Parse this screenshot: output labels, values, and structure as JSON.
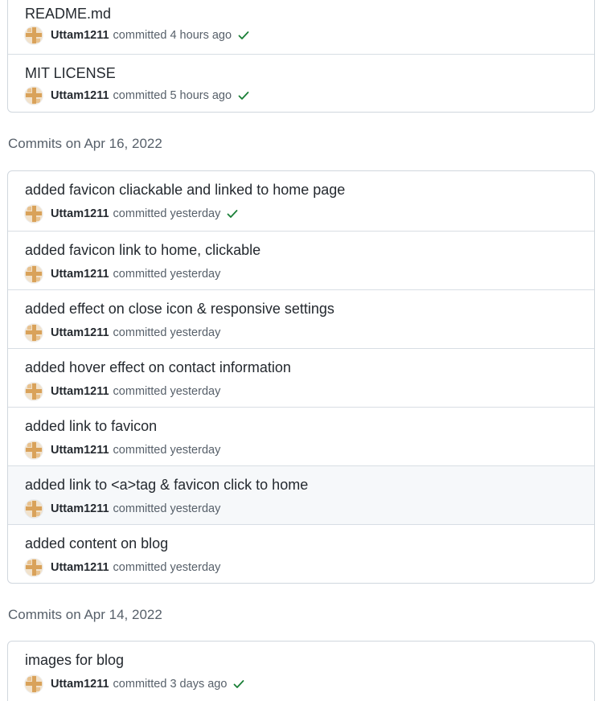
{
  "groups_top": {
    "commits": [
      {
        "title": "README.md",
        "author": "Uttam1211",
        "verb": "committed",
        "time": "4 hours ago",
        "status": "success"
      },
      {
        "title": "MIT LICENSE",
        "author": "Uttam1211",
        "verb": "committed",
        "time": "5 hours ago",
        "status": "success"
      }
    ]
  },
  "group_apr16": {
    "heading": "Commits on Apr 16, 2022",
    "commits": [
      {
        "title": "added favicon cliackable and linked to home page",
        "author": "Uttam1211",
        "verb": "committed",
        "time": "yesterday",
        "status": "success"
      },
      {
        "title": "added favicon link to home, clickable",
        "author": "Uttam1211",
        "verb": "committed",
        "time": "yesterday"
      },
      {
        "title": "added effect on close icon & responsive settings",
        "author": "Uttam1211",
        "verb": "committed",
        "time": "yesterday"
      },
      {
        "title": "added hover effect on contact information",
        "author": "Uttam1211",
        "verb": "committed",
        "time": "yesterday"
      },
      {
        "title": "added link to favicon",
        "author": "Uttam1211",
        "verb": "committed",
        "time": "yesterday"
      },
      {
        "title": "added link to <a>tag & favicon click to home",
        "author": "Uttam1211",
        "verb": "committed",
        "time": "yesterday"
      },
      {
        "title": "added content on blog",
        "author": "Uttam1211",
        "verb": "committed",
        "time": "yesterday"
      }
    ]
  },
  "group_apr14": {
    "heading": "Commits on Apr 14, 2022",
    "commits": [
      {
        "title": "images for blog",
        "author": "Uttam1211",
        "verb": "committed",
        "time": "3 days ago",
        "status": "success"
      }
    ]
  },
  "colors": {
    "success": "#1a7f37",
    "border": "#d0d7de",
    "muted_text": "#57606a"
  },
  "icons": {
    "status": "check-icon",
    "avatar": "identicon-avatar"
  }
}
